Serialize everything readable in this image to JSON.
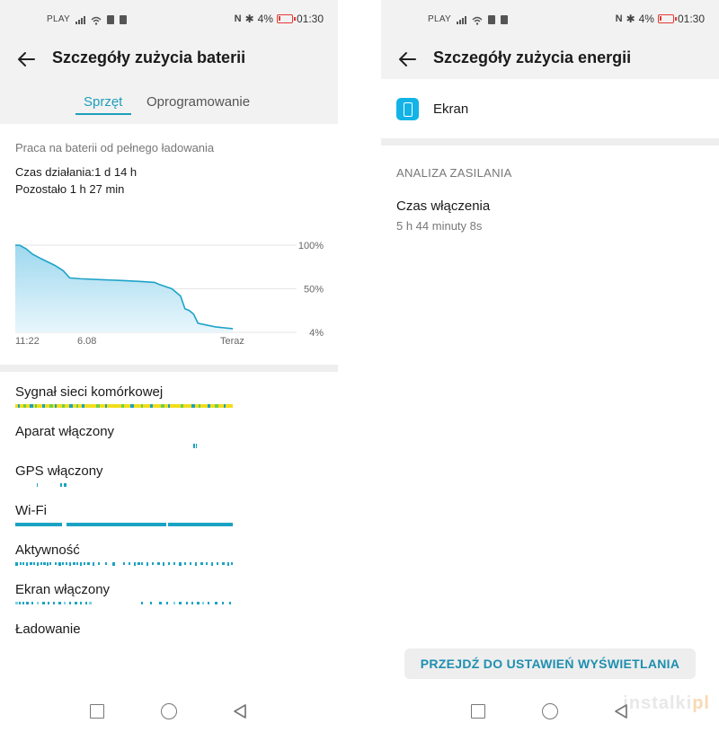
{
  "status_bar": {
    "carrier": "PLAY",
    "battery_percent": "4%",
    "time": "01:30"
  },
  "left": {
    "title": "Szczegóły zużycia baterii",
    "tabs": [
      {
        "label": "Sprzęt",
        "active": true
      },
      {
        "label": "Oprogramowanie",
        "active": false
      }
    ],
    "subtitle": "Praca na baterii od pełnego ładowania",
    "uptime": "Czas działania:1 d 14 h",
    "remaining": "Pozostało 1 h 27 min",
    "activities": [
      {
        "label": "Sygnał sieci komórkowej"
      },
      {
        "label": "Aparat włączony"
      },
      {
        "label": "GPS włączony"
      },
      {
        "label": "Wi-Fi"
      },
      {
        "label": "Aktywność"
      },
      {
        "label": "Ekran włączony"
      },
      {
        "label": "Ładowanie"
      }
    ]
  },
  "chart_data": {
    "type": "area",
    "title": "",
    "x_tick_labels": [
      "11:22",
      "6.08",
      "Teraz"
    ],
    "y_tick_labels": [
      "100%",
      "50%",
      "4%"
    ],
    "ylim": [
      4,
      100
    ],
    "x": [
      0,
      0.02,
      0.05,
      0.08,
      0.12,
      0.18,
      0.22,
      0.25,
      0.3,
      0.4,
      0.5,
      0.58,
      0.64,
      0.66,
      0.72,
      0.76,
      0.78,
      0.8,
      0.82,
      0.84,
      0.88,
      0.92,
      1.0
    ],
    "y": [
      100,
      100,
      96,
      90,
      85,
      78,
      72,
      64,
      63,
      62,
      61,
      60,
      59,
      57,
      52,
      44,
      30,
      28,
      24,
      14,
      12,
      10,
      8
    ],
    "colors": {
      "line": "#1ea3c9",
      "fill_top": "#9ed8ee",
      "fill_bottom": "#e8f6fc"
    }
  },
  "right": {
    "title": "Szczegóły zużycia energii",
    "app_name": "Ekran",
    "section": "ANALIZA ZASILANIA",
    "on_time_label": "Czas włączenia",
    "on_time_value": "5 h 44 minuty 8s",
    "button_label": "PRZEJDŹ DO USTAWIEŃ WYŚWIETLANIA"
  },
  "watermark": {
    "main": "instalki",
    "accent": "pl"
  },
  "colors": {
    "accent": "#1e9ebb",
    "activity_teal": "#1aa3c4",
    "activity_yellow": "#f2dd1c",
    "activity_green": "#6fd04b"
  }
}
